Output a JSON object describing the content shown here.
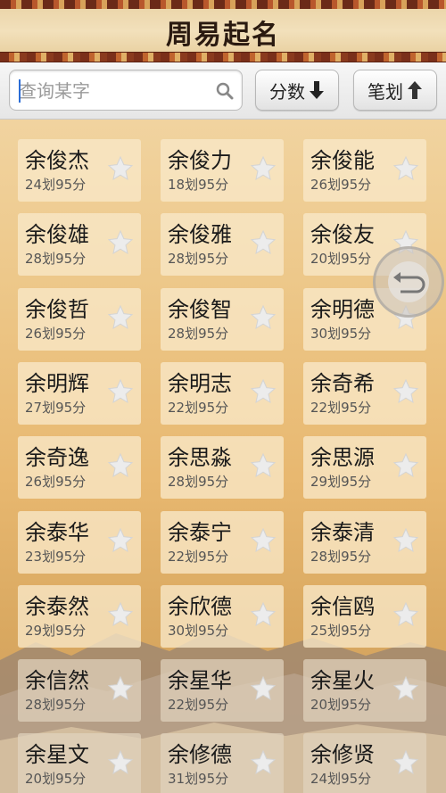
{
  "header": {
    "title": "周易起名"
  },
  "toolbar": {
    "search_placeholder": "查询某字",
    "score_button": "分数",
    "stroke_button": "笔划"
  },
  "names": [
    {
      "name": "余俊杰",
      "score": "24划95分"
    },
    {
      "name": "余俊力",
      "score": "18划95分"
    },
    {
      "name": "余俊能",
      "score": "26划95分"
    },
    {
      "name": "余俊雄",
      "score": "28划95分"
    },
    {
      "name": "余俊雅",
      "score": "28划95分"
    },
    {
      "name": "余俊友",
      "score": "20划95分"
    },
    {
      "name": "余俊哲",
      "score": "26划95分"
    },
    {
      "name": "余俊智",
      "score": "28划95分"
    },
    {
      "name": "余明德",
      "score": "30划95分"
    },
    {
      "name": "余明辉",
      "score": "27划95分"
    },
    {
      "name": "余明志",
      "score": "22划95分"
    },
    {
      "name": "余奇希",
      "score": "22划95分"
    },
    {
      "name": "余奇逸",
      "score": "26划95分"
    },
    {
      "name": "余思淼",
      "score": "28划95分"
    },
    {
      "name": "余思源",
      "score": "29划95分"
    },
    {
      "name": "余泰华",
      "score": "23划95分"
    },
    {
      "name": "余泰宁",
      "score": "22划95分"
    },
    {
      "name": "余泰清",
      "score": "28划95分"
    },
    {
      "name": "余泰然",
      "score": "29划95分"
    },
    {
      "name": "余欣德",
      "score": "30划95分"
    },
    {
      "name": "余信鸥",
      "score": "25划95分"
    },
    {
      "name": "余信然",
      "score": "28划95分"
    },
    {
      "name": "余星华",
      "score": "22划95分"
    },
    {
      "name": "余星火",
      "score": "20划95分"
    },
    {
      "name": "余星文",
      "score": "20划95分"
    },
    {
      "name": "余修德",
      "score": "31划95分"
    },
    {
      "name": "余修贤",
      "score": "24划95分"
    }
  ],
  "colors": {
    "header_band": "#7a2f1a",
    "card_bg": "#f8e8c8",
    "star": "#e2e2e2"
  },
  "icons": {
    "search": "search-icon",
    "score_arrow": "arrow-down-icon",
    "stroke_arrow": "arrow-up-icon",
    "favorite": "star-icon",
    "back": "back-icon"
  }
}
